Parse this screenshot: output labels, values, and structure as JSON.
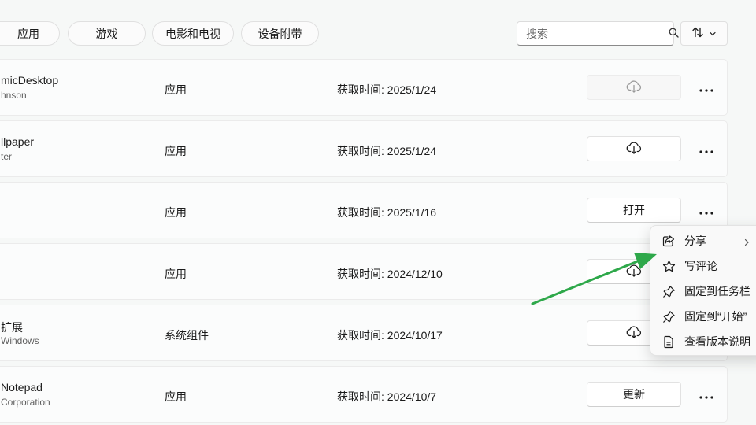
{
  "filters": [
    "应用",
    "游戏",
    "电影和电视",
    "设备附带"
  ],
  "search": {
    "placeholder": "搜索"
  },
  "rows": [
    {
      "name": "micDesktop",
      "publisher": "hnson",
      "type": "应用",
      "date": "获取时间: 2025/1/24",
      "action": "",
      "action_icon": "cloud-download-icon",
      "disabled": true
    },
    {
      "name": "llpaper",
      "publisher": "ter",
      "type": "应用",
      "date": "获取时间: 2025/1/24",
      "action": "",
      "action_icon": "cloud-download-icon",
      "disabled": false
    },
    {
      "name": "",
      "publisher": "",
      "type": "应用",
      "date": "获取时间: 2025/1/16",
      "action": "打开",
      "action_icon": "",
      "disabled": false
    },
    {
      "name": "",
      "publisher": "",
      "type": "应用",
      "date": "获取时间: 2024/12/10",
      "action": "",
      "action_icon": "cloud-download-icon",
      "disabled": false
    },
    {
      "name": "扩展",
      "publisher": "Windows",
      "type": "系统组件",
      "date": "获取时间: 2024/10/17",
      "action": "",
      "action_icon": "cloud-download-icon",
      "disabled": false
    },
    {
      "name": "Notepad",
      "publisher": "Corporation",
      "type": "应用",
      "date": "获取时间: 2024/10/7",
      "action": "更新",
      "action_icon": "",
      "disabled": false
    }
  ],
  "context_menu": [
    {
      "label": "分享",
      "icon": "share-icon",
      "submenu": true
    },
    {
      "label": "写评论",
      "icon": "star-icon",
      "submenu": false
    },
    {
      "label": "固定到任务栏",
      "icon": "pin-icon",
      "submenu": false
    },
    {
      "label": "固定到“开始”",
      "icon": "pin-icon",
      "submenu": false
    },
    {
      "label": "查看版本说明",
      "icon": "document-icon",
      "submenu": false
    }
  ],
  "colors": {
    "accent_arrow": "#2ea84a",
    "background": "#f6f8f7"
  }
}
